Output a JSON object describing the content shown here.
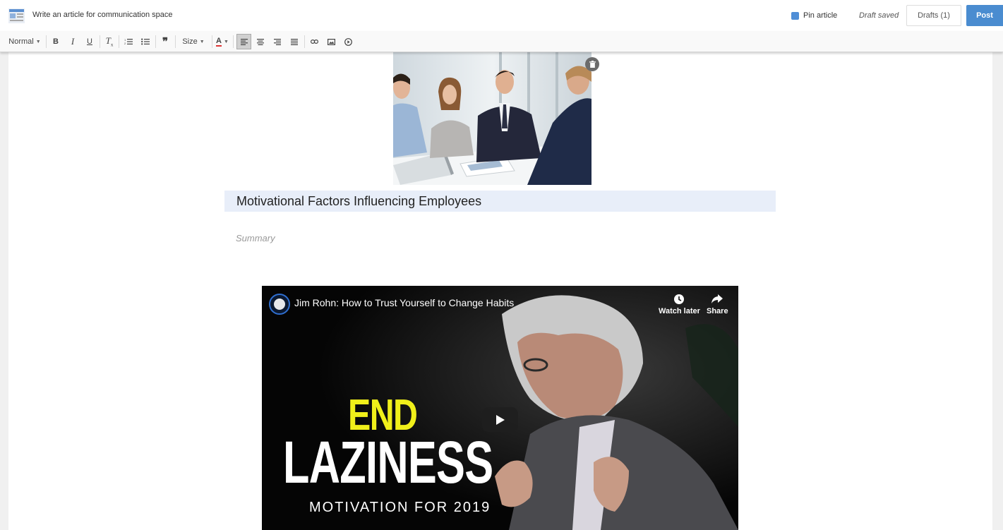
{
  "header": {
    "app_icon": "article-icon",
    "title": "Write an article for communication space",
    "pin_label": "Pin article",
    "pin_checked": true,
    "draft_status": "Draft saved",
    "drafts_label": "Drafts (1)",
    "post_label": "Post",
    "accent_color": "#4a8cd0"
  },
  "toolbar": {
    "format_label": "Normal",
    "size_label": "Size",
    "buttons": [
      "bold-icon",
      "italic-icon",
      "underline-icon",
      "clear-format-icon",
      "numbered-list-icon",
      "bullet-list-icon",
      "quote-icon",
      "font-color-icon",
      "align-left-icon",
      "align-center-icon",
      "align-right-icon",
      "justify-icon",
      "link-icon",
      "image-icon",
      "video-icon"
    ],
    "active_alignment": "align-left"
  },
  "editor": {
    "cover_image": "photo of four colleagues in a business meeting",
    "title": "Motivational Factors Influencing Employees",
    "summary_placeholder": "Summary",
    "video": {
      "title": "Jim Rohn: How to Trust Yourself to Change Habits",
      "watch_later_label": "Watch later",
      "share_label": "Share",
      "thumb_line1": "END",
      "thumb_line2": "LAZINESS",
      "thumb_line3": "MOTIVATION FOR 2019"
    }
  }
}
